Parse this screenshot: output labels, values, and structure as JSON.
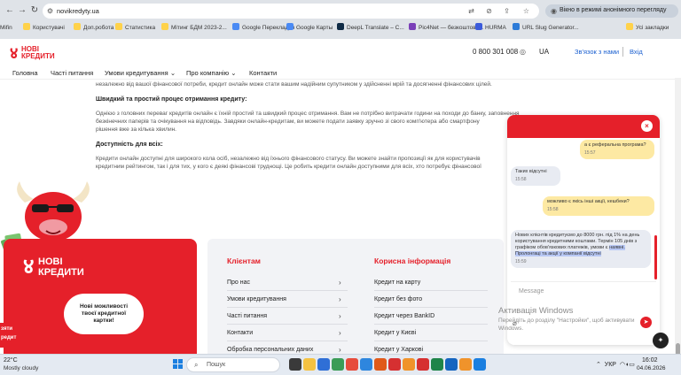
{
  "browser": {
    "url": "novikredyty.ua",
    "incognito_label": "Вікно в режимі анонімного перегляду",
    "bookmarks": [
      "Mifin",
      "Користувачі",
      "Доп.робота",
      "Статистика",
      "Мітинг БДМ 2023-2...",
      "Google Перекладач",
      "Google Карты",
      "DeepL Translate – С...",
      "Pic4Net — безкоштовн...",
      "HURMA",
      "URL Slug Generator...",
      "Усі закладки"
    ],
    "bookmark_colors": [
      "#1b7fe0",
      "#ffd24a",
      "#ffd24a",
      "#ffd24a",
      "#ffd24a",
      "#4a8af4",
      "#4a8af4",
      "#0f2b46",
      "#7a3fb8",
      "#3b5bdb",
      "#2d7bd8",
      "#ffd24a"
    ]
  },
  "site": {
    "logo_line1": "НОВІ",
    "logo_line2": "КРЕДИТИ",
    "phone": "0 800 301 008",
    "language": "UA",
    "contact_us": "Зв'язок з нами",
    "login": "Вхід",
    "nav": [
      "Головна",
      "Часті питання",
      "Умови кредитування",
      "Про компанію",
      "Контакти"
    ]
  },
  "article": {
    "p0": "незалежно від вашої фінансової потреби, кредит онлайн може стати вашим надійним супутником у здійсненні мрій та досягненні фінансових цілей.",
    "h1": "Швидкий та простий процес отримання кредиту:",
    "p1a": "Однією з головних переваг кредитів онлайн є їхній простий та швидкий процес отримання. Вам не потрібно витрачати години на походи до банку, заповнення",
    "p1b": "безкінечних паперів та очікування на відповідь. Завдяки онлайн-кредитам, ви можете подати заявку зручно зі свого комп'ютера або смартфону",
    "p1c": "рішення вже за кілька хвилин.",
    "h2": "Доступність для всіх:",
    "p2a": "Кредити онлайн доступні для широкого кола осіб, незалежно від їхнього фінансового статусу. Ви можете знайти пропозиції як для користувачів",
    "p2b": "кредитним рейтингом, так і для тих, у кого є деякі фінансові труднощі. Це робить кредити онлайн доступними для всіх, хто потребує фінансової"
  },
  "footer": {
    "card_logo_line1": "НОВІ",
    "card_logo_line2": "КРЕДИТИ",
    "bubble_text_line1": "Нові можливості",
    "bubble_text_line2": "твоєї кредитної",
    "bubble_text_line3": "картки!",
    "side_tab_line1": "зяти",
    "side_tab_line2": "редит",
    "col1_title": "Клієнтам",
    "col1_links": [
      "Про нас",
      "Умови кредитування",
      "Часті питання",
      "Контакти",
      "Обробка персональних даних"
    ],
    "col2_title": "Корисна інформація",
    "col2_links": [
      "Кредит на карту",
      "Кредит без фото",
      "Кредит через BankID",
      "Кредит у Києві",
      "Кредит у Харкові"
    ]
  },
  "chat": {
    "messages": [
      {
        "dir": "out",
        "text": "а є реферальна програма?",
        "time": "15:57"
      },
      {
        "dir": "in",
        "text": "Таких відсутні",
        "time": "15:58"
      },
      {
        "dir": "out",
        "text": "можливо є якісь інші акції, кешбеки?",
        "time": "15:58"
      },
      {
        "dir": "in",
        "text_a": "Нових клієнтів кредитуємо до 8000 грн. під 1% на день користування кредитними коштами. Термін 105 днів з графіком обов'язкових платежів, умови є",
        "text_b": "наявні. Пролонгаці та акції у компанії відсутні",
        "time": "15:59"
      }
    ],
    "input_placeholder": "Message"
  },
  "watermark": {
    "line1": "Активація Windows",
    "line2": "Перейдіть до розділу \"Настройки\", щоб активувати",
    "line3": "Windows."
  },
  "taskbar": {
    "temperature": "22°C",
    "weather": "Mostly cloudy",
    "search_placeholder": "Пошук",
    "keyboard_lang": "УКР",
    "time": "16:02",
    "date": "04.06.2026",
    "app_colors": [
      "#3a3a3a",
      "#f5c242",
      "#2f6fd6",
      "#3b9c57",
      "#e74c3c",
      "#2e86de",
      "#e05a1a",
      "#d63031",
      "#f0932b",
      "#d63031",
      "#1e8449",
      "#1565c0",
      "#f0932b",
      "#1b7fe0"
    ]
  }
}
